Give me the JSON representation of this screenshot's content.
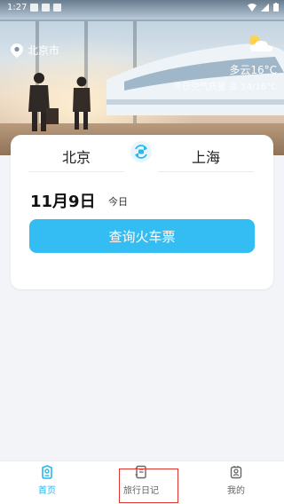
{
  "status_bar": {
    "time": "1:27"
  },
  "header": {
    "location": "北京市",
    "weather": {
      "condition_temp": "多云16°C",
      "detail": "今日空气质量 良 14/16°C"
    }
  },
  "search_card": {
    "from_city": "北京",
    "to_city": "上海",
    "date": "11月9日",
    "day_label": "今日",
    "search_button": "查询火车票"
  },
  "tabbar": {
    "items": [
      {
        "label": "首页",
        "icon": "home-icon",
        "active": true
      },
      {
        "label": "旅行日记",
        "icon": "diary-icon",
        "active": false
      },
      {
        "label": "我的",
        "icon": "profile-icon",
        "active": false
      }
    ]
  },
  "colors": {
    "accent": "#34bdf2",
    "active_tab": "#27b7ef",
    "highlight": "#e0322e"
  }
}
